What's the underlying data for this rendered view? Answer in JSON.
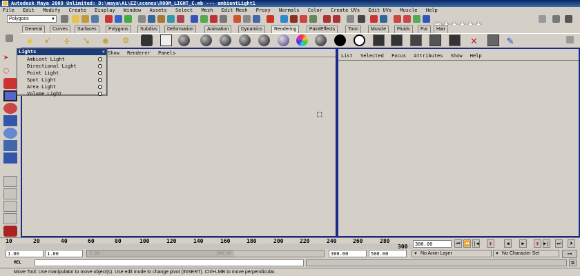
{
  "title": "Autodesk Maya 2009 Unlimited: D:\\maya\\AL\\EZ\\scenes\\ROOM_LIGHT_C.mb  ---  ambientLight1",
  "menus": [
    "File",
    "Edit",
    "Modify",
    "Create",
    "Display",
    "Window",
    "Assets",
    "Select",
    "Mesh",
    "Edit Mesh",
    "Proxy",
    "Normals",
    "Color",
    "Create UVs",
    "Edit UVs",
    "Muscle",
    "Help"
  ],
  "mode_select": "Polygons",
  "shelf_tabs": [
    "General",
    "Curves",
    "Surfaces",
    "Polygons",
    "Subdivs",
    "Deformation",
    "Animation",
    "Dynamics",
    "Rendering",
    "PaintEffects",
    "Toon",
    "Muscle",
    "Fluids",
    "Fur",
    "Hair"
  ],
  "active_shelf_tab": "Rendering",
  "left_panel_menu": [
    "Show",
    "Renderer",
    "Panels"
  ],
  "right_panel_menu": [
    "List",
    "Selected",
    "Focus",
    "Attributes",
    "Show",
    "Help"
  ],
  "lights_menu": {
    "title": "Lights",
    "items": [
      "Ambient Light",
      "Directional Light",
      "Point Light",
      "Spot Light",
      "Area Light",
      "Volume Light"
    ]
  },
  "timeline": {
    "ticks": [
      "10",
      "20",
      "40",
      "60",
      "80",
      "100",
      "120",
      "140",
      "160",
      "180",
      "200",
      "220",
      "240",
      "260",
      "280",
      "300"
    ],
    "current_frame": "300.00"
  },
  "range": {
    "start": "1.00",
    "playback_start": "1.00",
    "slider_start": "1.00",
    "slider_end": "300.00",
    "playback_end": "300.00",
    "end": "500.00",
    "anim_layer": "No Anim Layer",
    "character_set": "No Character Set"
  },
  "mel_label": "MEL",
  "help_text": "Move Tool: Use manipulator to move object(s). Use edit mode to change pivot (INSERT).  Ctrl+LMB to move perpendicular."
}
